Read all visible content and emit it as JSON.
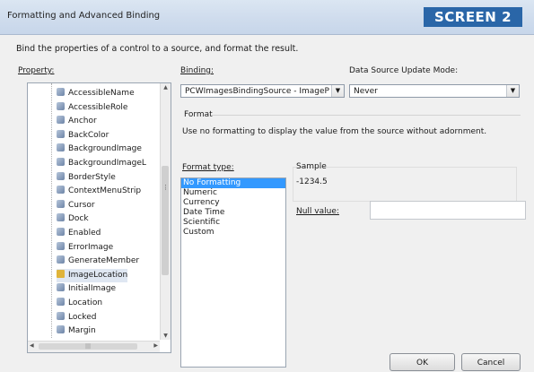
{
  "window": {
    "title": "Formatting and Advanced Binding",
    "badge": "SCREEN 2"
  },
  "description": "Bind the properties of a control to a source, and format the result.",
  "property": {
    "label": "Property:",
    "items": [
      {
        "label": "AccessibleName",
        "icon": "property-icon"
      },
      {
        "label": "AccessibleRole",
        "icon": "property-icon"
      },
      {
        "label": "Anchor",
        "icon": "property-icon"
      },
      {
        "label": "BackColor",
        "icon": "property-icon"
      },
      {
        "label": "BackgroundImage",
        "icon": "property-icon"
      },
      {
        "label": "BackgroundImageL",
        "icon": "property-icon"
      },
      {
        "label": "BorderStyle",
        "icon": "property-icon"
      },
      {
        "label": "ContextMenuStrip",
        "icon": "property-icon"
      },
      {
        "label": "Cursor",
        "icon": "property-icon"
      },
      {
        "label": "Dock",
        "icon": "property-icon"
      },
      {
        "label": "Enabled",
        "icon": "property-icon"
      },
      {
        "label": "ErrorImage",
        "icon": "property-icon"
      },
      {
        "label": "GenerateMember",
        "icon": "property-icon"
      },
      {
        "label": "ImageLocation",
        "icon": "bound-property-icon"
      },
      {
        "label": "InitialImage",
        "icon": "property-icon"
      },
      {
        "label": "Location",
        "icon": "property-icon"
      },
      {
        "label": "Locked",
        "icon": "property-icon"
      },
      {
        "label": "Margin",
        "icon": "property-icon"
      }
    ],
    "selected": "ImageLocation"
  },
  "binding": {
    "label": "Binding:",
    "value": "PCWImagesBindingSource - ImageP"
  },
  "update_mode": {
    "label": "Data Source Update Mode:",
    "value": "Never"
  },
  "format": {
    "section_label": "Format",
    "hint": "Use no formatting to display the value from the source without adornment.",
    "type_label": "Format type:",
    "types": [
      "No Formatting",
      "Numeric",
      "Currency",
      "Date Time",
      "Scientific",
      "Custom"
    ],
    "selected": "No Formatting",
    "sample_label": "Sample",
    "sample_value": "-1234.5",
    "null_label": "Null value:",
    "null_value": ""
  },
  "buttons": {
    "ok": "OK",
    "cancel": "Cancel"
  },
  "colors": {
    "badge": "#2a66a8",
    "selection": "#3399ff",
    "titlebar": "#cfdced"
  }
}
